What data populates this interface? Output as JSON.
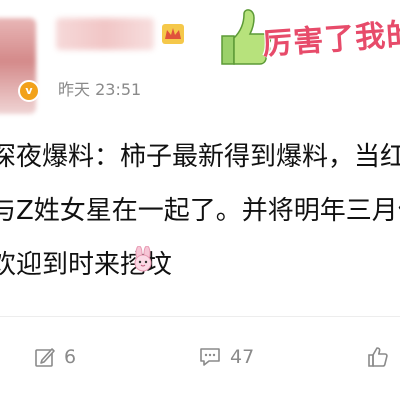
{
  "post": {
    "timestamp": "昨天 23:51",
    "text_lines": [
      "深夜爆料：柿子最新得到爆料，当红小鲜肉L",
      "与Z姓女星在一起了。并将明年三月份左右公",
      "欢迎到时来挖坟"
    ]
  },
  "sticker": {
    "text": "厉害了我的"
  },
  "actions": {
    "repost_count": "6",
    "comment_count": "47"
  },
  "colors": {
    "muted": "#8a8a8a",
    "sticker_pink": "#e74b6a",
    "badge_orange": "#f2a11a"
  },
  "icons": {
    "crown": "crown-icon",
    "bunny": "bunny-emoji-icon",
    "repost": "repost-icon",
    "comment": "comment-icon",
    "like": "thumbs-up-icon",
    "sticker": "thumbs-up-sticker"
  }
}
